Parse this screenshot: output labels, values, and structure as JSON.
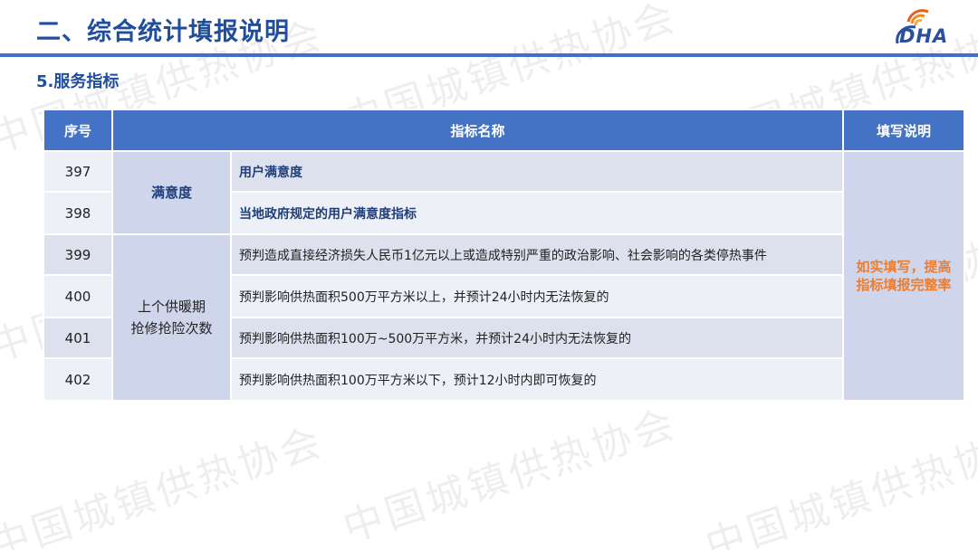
{
  "header": {
    "title": "二、综合统计填报说明",
    "logo_text": "DHA",
    "accent_color": "#3f6fc8"
  },
  "subtitle": "5.服务指标",
  "watermark_text": "中国城镇供热协会",
  "table": {
    "columns": [
      "序号",
      "指标名称",
      "填写说明"
    ],
    "groups": [
      {
        "category": "满意度",
        "rows": [
          {
            "id": "397",
            "name": "用户满意度"
          },
          {
            "id": "398",
            "name": "当地政府规定的用户满意度指标"
          }
        ]
      },
      {
        "category_line1": "上个供暖期",
        "category_line2": "抢修抢险次数",
        "rows": [
          {
            "id": "399",
            "name": "预判造成直接经济损失人民币1亿元以上或造成特别严重的政治影响、社会影响的各类停热事件"
          },
          {
            "id": "400",
            "name": "预判影响供热面积500万平方米以上，并预计24小时内无法恢复的"
          },
          {
            "id": "401",
            "name": "预判影响供热面积100万~500万平方米，并预计24小时内无法恢复的"
          },
          {
            "id": "402",
            "name": "预判影响供热面积100万平方米以下，预计12小时内即可恢复的"
          }
        ]
      }
    ],
    "note_line1": "如实填写，提高",
    "note_line2": "指标填报完整率",
    "header_color": "#4472c4",
    "note_color": "#ed7d31"
  }
}
